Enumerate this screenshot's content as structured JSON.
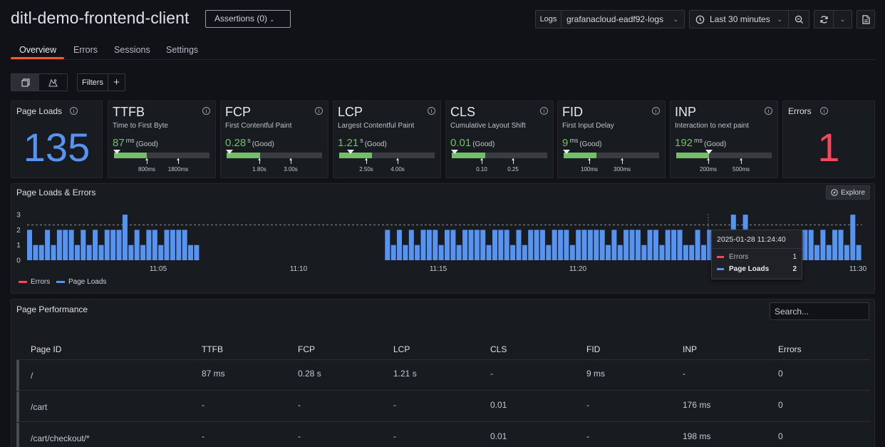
{
  "header": {
    "title": "ditl-demo-frontend-client",
    "assertions_label": "Assertions (0)",
    "logs_label": "Logs",
    "logs_datasource": "grafanacloud-eadf92-logs",
    "time_range": "Last 30 minutes"
  },
  "tabs": [
    {
      "label": "Overview",
      "active": true
    },
    {
      "label": "Errors",
      "active": false
    },
    {
      "label": "Sessions",
      "active": false
    },
    {
      "label": "Settings",
      "active": false
    }
  ],
  "filters": {
    "label": "Filters"
  },
  "colors": {
    "good": "#73bf69",
    "page_loads": "#5794f2",
    "errors": "#f2495c"
  },
  "stats": {
    "page_loads": {
      "title": "Page Loads",
      "value": "135"
    },
    "errors": {
      "title": "Errors",
      "value": "1"
    }
  },
  "metrics": [
    {
      "abbr": "TTFB",
      "name": "Time to First Byte",
      "value": "87",
      "unit": "ms",
      "rating": "(Good)",
      "thresholds": [
        "800ms",
        "1800ms"
      ]
    },
    {
      "abbr": "FCP",
      "name": "First Contentful Paint",
      "value": "0.28",
      "unit": "s",
      "rating": "(Good)",
      "thresholds": [
        "1.80s",
        "3.00s"
      ]
    },
    {
      "abbr": "LCP",
      "name": "Largest Contentful Paint",
      "value": "1.21",
      "unit": "s",
      "rating": "(Good)",
      "thresholds": [
        "2.50s",
        "4.00s"
      ]
    },
    {
      "abbr": "CLS",
      "name": "Cumulative Layout Shift",
      "value": "0.01",
      "unit": "",
      "rating": "(Good)",
      "thresholds": [
        "0.10",
        "0.25"
      ]
    },
    {
      "abbr": "FID",
      "name": "First Input Delay",
      "value": "9",
      "unit": "ms",
      "rating": "(Good)",
      "thresholds": [
        "100ms",
        "300ms"
      ]
    },
    {
      "abbr": "INP",
      "name": "Interaction to next paint",
      "value": "192",
      "unit": "ms",
      "rating": "(Good)",
      "thresholds": [
        "200ms",
        "500ms"
      ]
    }
  ],
  "chart": {
    "title": "Page Loads & Errors",
    "explore_label": "Explore",
    "legend": [
      "Errors",
      "Page Loads"
    ],
    "tooltip": {
      "time": "2025-01-28 11:24:40",
      "rows": [
        {
          "label": "Errors",
          "value": "1"
        },
        {
          "label": "Page Loads",
          "value": "2"
        }
      ]
    }
  },
  "chart_data": {
    "type": "bar",
    "title": "Page Loads & Errors",
    "y_ticks": [
      "0",
      "1",
      "2",
      "3"
    ],
    "ylim": [
      0,
      3
    ],
    "x_ticks": [
      "11:05",
      "11:10",
      "11:15",
      "11:20",
      "11:30"
    ],
    "series": [
      {
        "name": "Page Loads",
        "values": [
          2,
          1,
          1,
          2,
          1,
          2,
          2,
          2,
          1,
          2,
          1,
          2,
          1,
          2,
          2,
          2,
          3,
          1,
          2,
          1,
          2,
          2,
          1,
          2,
          2,
          2,
          2,
          1,
          1,
          0,
          0,
          0,
          0,
          0,
          0,
          0,
          0,
          0,
          0,
          0,
          0,
          0,
          0,
          0,
          0,
          0,
          0,
          0,
          0,
          0,
          0,
          0,
          0,
          0,
          0,
          0,
          0,
          0,
          0,
          0,
          2,
          1,
          2,
          1,
          2,
          1,
          2,
          2,
          2,
          1,
          2,
          2,
          1,
          2,
          2,
          2,
          2,
          1,
          2,
          2,
          2,
          1,
          2,
          1,
          2,
          2,
          2,
          1,
          2,
          2,
          2,
          1,
          2,
          2,
          2,
          2,
          2,
          1,
          2,
          1,
          2,
          2,
          2,
          1,
          2,
          2,
          1,
          2,
          2,
          2,
          1,
          1,
          2,
          1,
          2,
          1,
          2,
          2,
          3,
          1,
          3,
          2,
          2,
          2,
          2,
          2,
          2,
          2,
          2,
          2,
          2,
          2,
          1,
          2,
          1,
          2,
          2,
          1,
          3,
          1
        ]
      },
      {
        "name": "Errors",
        "values": [
          0,
          0,
          0,
          0,
          0,
          0,
          0,
          0,
          0,
          0,
          0,
          0,
          0,
          0,
          0,
          0,
          0,
          0,
          0,
          0,
          0,
          0,
          0,
          0,
          0,
          0,
          0,
          0,
          0,
          0,
          0,
          0,
          0,
          0,
          0,
          0,
          0,
          0,
          0,
          0,
          0,
          0,
          0,
          0,
          0,
          0,
          0,
          0,
          0,
          0,
          0,
          0,
          0,
          0,
          0,
          0,
          0,
          0,
          0,
          0,
          0,
          0,
          0,
          0,
          0,
          0,
          0,
          0,
          0,
          0,
          0,
          0,
          0,
          0,
          0,
          0,
          0,
          0,
          0,
          0,
          0,
          0,
          0,
          0,
          0,
          0,
          0,
          0,
          0,
          0,
          0,
          0,
          0,
          0,
          0,
          0,
          0,
          0,
          0,
          0,
          0,
          0,
          0,
          0,
          0,
          0,
          0,
          0,
          0,
          0,
          0,
          0,
          0,
          0,
          0,
          0,
          0,
          0,
          0,
          0,
          1,
          0,
          0,
          0,
          0,
          0,
          0,
          0,
          0,
          0,
          0,
          0,
          0,
          0,
          0,
          0,
          0,
          0,
          0,
          0
        ]
      }
    ]
  },
  "performance": {
    "title": "Page Performance",
    "search_placeholder": "Search...",
    "columns": [
      "Page ID",
      "TTFB",
      "FCP",
      "LCP",
      "CLS",
      "FID",
      "INP",
      "Errors"
    ],
    "rows": [
      [
        "/",
        "87 ms",
        "0.28 s",
        "1.21 s",
        "-",
        "9 ms",
        "-",
        "0"
      ],
      [
        "/cart",
        "-",
        "-",
        "-",
        "0.01",
        "-",
        "176 ms",
        "0"
      ],
      [
        "/cart/checkout/*",
        "-",
        "-",
        "-",
        "0.01",
        "-",
        "198 ms",
        "0"
      ]
    ]
  }
}
